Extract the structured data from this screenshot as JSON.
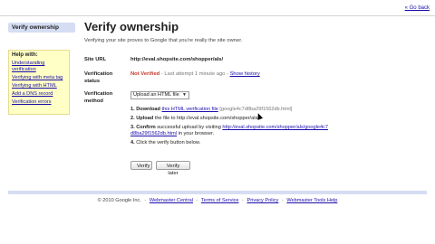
{
  "topbar": {
    "back_link": "« Go back"
  },
  "sidebar": {
    "current": "Verify ownership",
    "help_title": "Help with:",
    "help_links": [
      "Understanding verification",
      "Verifying with meta tag",
      "Verifying with HTML",
      "Add a DNS record",
      "Verification errors"
    ]
  },
  "main": {
    "title": "Verify ownership",
    "subtitle": "Verifying your site proves to Google that you're really the site owner.",
    "site_url_label": "Site URL",
    "site_url_value": "http://eval.shopsite.com/shopper/als/",
    "status_label": "Verification status",
    "status_value": "Not Verified",
    "status_detail": " - Last attempt 1 minute ago - ",
    "show_history": "Show history",
    "method_label": "Verification method",
    "method_selected": "Upload an HTML file",
    "steps": {
      "s1_num": "1.",
      "s1_bold": "Download",
      "s1_link": "this HTML verification file",
      "s1_file": "[google4c7d8ba29f1562db.html]",
      "s2_num": "2.",
      "s2_bold": "Upload",
      "s2_text": "the file to http://eval.shopsite.com/shopper/als/",
      "s3_num": "3.",
      "s3_bold": "Confirm",
      "s3_text": "successful upload by visiting",
      "s3_link": "http://eval.shopsite.com/shopper/als/google4c7d8ba29f1562db.html",
      "s3_suffix": "in your browser.",
      "s4_num": "4.",
      "s4_text": "Click the verify button below."
    },
    "verify_button": "Verify",
    "verify_later_button": "Verify later"
  },
  "footer": {
    "copyright": "© 2010 Google Inc.",
    "links": [
      "Webmaster Central",
      "Terms of Service",
      "Privacy Policy",
      "Webmaster Tools Help"
    ],
    "separator": "-"
  },
  "colors": {
    "link": "#1a0dab",
    "status_error": "#c0392b",
    "help_bg": "#ffffc6",
    "nav_bg": "#d5ddf3"
  }
}
